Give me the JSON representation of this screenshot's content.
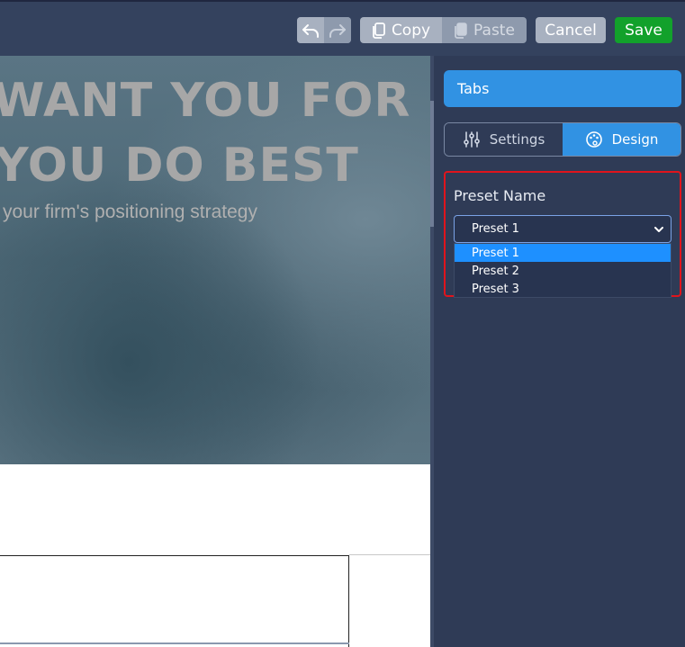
{
  "toolbar": {
    "copy_label": "Copy",
    "paste_label": "Paste",
    "cancel_label": "Cancel",
    "save_label": "Save",
    "icons": [
      "undo-icon",
      "redo-icon",
      "copy-icon",
      "paste-icon"
    ]
  },
  "hero": {
    "line1": "WANT YOU FOR",
    "line2": "YOU DO BEST",
    "subtitle": "your firm's positioning strategy"
  },
  "panel": {
    "title": "Tabs",
    "tabs": [
      {
        "label": "Settings",
        "icon": "sliders-icon",
        "active": false
      },
      {
        "label": "Design",
        "icon": "palette-icon",
        "active": true
      }
    ],
    "preset": {
      "label": "Preset Name",
      "selected": "Preset 1",
      "options": [
        "Preset 1",
        "Preset 2",
        "Preset 3"
      ]
    }
  },
  "colors": {
    "accent": "#3192e3",
    "save": "#12a12b",
    "highlight": "#e0141c",
    "panel_bg": "#2f3b56"
  }
}
